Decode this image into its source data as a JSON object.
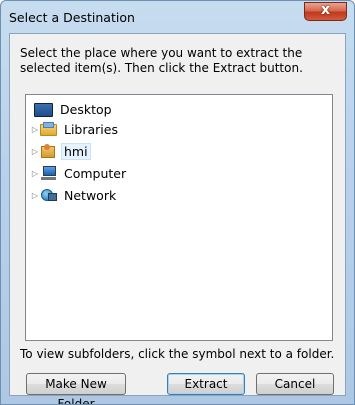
{
  "window": {
    "title": "Select a Destination",
    "close_label": "x"
  },
  "instructions": "Select the place where you want to extract the selected item(s).  Then click the Extract button.",
  "tree": [
    {
      "label": "Desktop",
      "icon": "desktop-icon",
      "expandable": false
    },
    {
      "label": "Libraries",
      "icon": "libraries-icon",
      "expandable": true
    },
    {
      "label": "hmi",
      "icon": "user-folder-icon",
      "expandable": true,
      "selected": true
    },
    {
      "label": "Computer",
      "icon": "computer-icon",
      "expandable": true
    },
    {
      "label": "Network",
      "icon": "network-icon",
      "expandable": true
    }
  ],
  "hint": "To view subfolders, click the symbol next to a folder.",
  "buttons": {
    "make_new_folder": "Make New Folder",
    "extract": "Extract",
    "cancel": "Cancel"
  }
}
